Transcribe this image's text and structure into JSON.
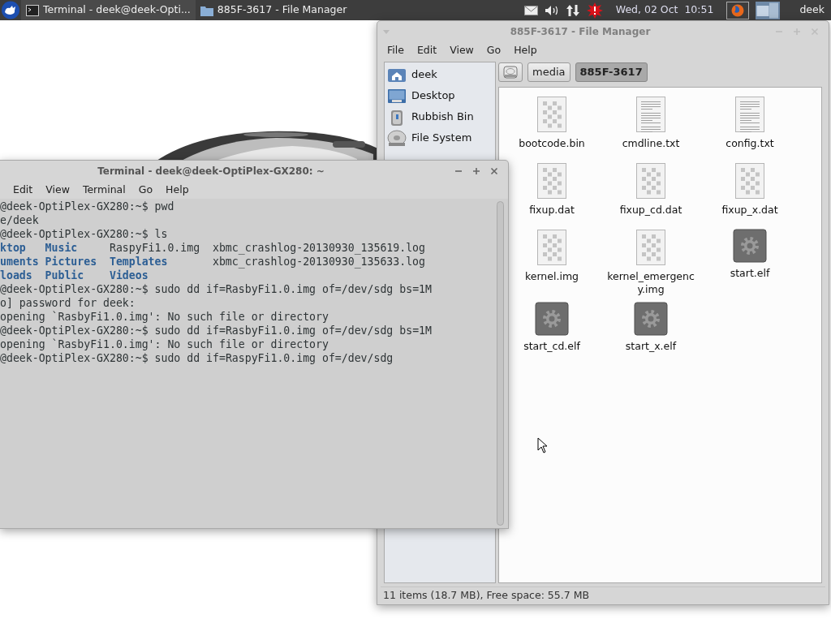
{
  "panel": {
    "tasks": [
      {
        "title": "Terminal - deek@deek-Opti...",
        "kind": "terminal",
        "selected": true
      },
      {
        "title": "885F-3617 - File Manager",
        "kind": "folder",
        "selected": false
      }
    ],
    "clock": "Wed, 02 Oct  10:51",
    "user": "deek"
  },
  "file_manager": {
    "title": "885F-3617 - File Manager",
    "menu": [
      "File",
      "Edit",
      "View",
      "Go",
      "Help"
    ],
    "sidebar": [
      {
        "label": "deek",
        "kind": "home"
      },
      {
        "label": "Desktop",
        "kind": "desktop"
      },
      {
        "label": "Rubbish Bin",
        "kind": "trash"
      },
      {
        "label": "File System",
        "kind": "drive"
      }
    ],
    "path": [
      {
        "label": "media",
        "selected": false
      },
      {
        "label": "885F-3617",
        "selected": true
      }
    ],
    "files": [
      {
        "name": "bootcode.bin",
        "kind": "binary"
      },
      {
        "name": "cmdline.txt",
        "kind": "text"
      },
      {
        "name": "config.txt",
        "kind": "text"
      },
      {
        "name": "fixup.dat",
        "kind": "binary"
      },
      {
        "name": "fixup_cd.dat",
        "kind": "binary"
      },
      {
        "name": "fixup_x.dat",
        "kind": "binary"
      },
      {
        "name": "kernel.img",
        "kind": "binary"
      },
      {
        "name": "kernel_emergency.img",
        "kind": "binary"
      },
      {
        "name": "start.elf",
        "kind": "executable"
      },
      {
        "name": "start_cd.elf",
        "kind": "executable"
      },
      {
        "name": "start_x.elf",
        "kind": "executable"
      }
    ],
    "status": "11 items (18.7 MB), Free space: 55.7 MB"
  },
  "terminal": {
    "title": "Terminal - deek@deek-OptiPlex-GX280: ~",
    "menu": [
      "Edit",
      "View",
      "Terminal",
      "Go",
      "Help"
    ],
    "lines": [
      {
        "kind": "text",
        "text": "@deek-OptiPlex-GX280:~$ pwd"
      },
      {
        "kind": "text",
        "text": "e/deek"
      },
      {
        "kind": "text",
        "text": "@deek-OptiPlex-GX280:~$ ls"
      },
      {
        "kind": "listing",
        "cells": [
          {
            "kind": "dir",
            "text": "ktop"
          },
          {
            "kind": "dir",
            "text": "Music"
          },
          {
            "kind": "file",
            "text": "RaspyFi1.0.img"
          },
          {
            "kind": "file",
            "text": "xbmc_crashlog-20130930_135619.log"
          }
        ]
      },
      {
        "kind": "listing",
        "cells": [
          {
            "kind": "dir",
            "text": "uments"
          },
          {
            "kind": "dir",
            "text": "Pictures"
          },
          {
            "kind": "dir",
            "text": "Templates"
          },
          {
            "kind": "file",
            "text": "xbmc_crashlog-20130930_135633.log"
          }
        ]
      },
      {
        "kind": "listing",
        "cells": [
          {
            "kind": "dir",
            "text": "loads"
          },
          {
            "kind": "dir",
            "text": "Public"
          },
          {
            "kind": "dir",
            "text": "Videos"
          }
        ]
      },
      {
        "kind": "text",
        "text": "@deek-OptiPlex-GX280:~$ sudo dd if=RasbyFi1.0.img of=/dev/sdg bs=1M"
      },
      {
        "kind": "text",
        "text": "o] password for deek:"
      },
      {
        "kind": "text",
        "text": "opening `RasbyFi1.0.img': No such file or directory"
      },
      {
        "kind": "text",
        "text": "@deek-OptiPlex-GX280:~$ sudo dd if=RasbyFi1.0.img of=/dev/sdg bs=1M"
      },
      {
        "kind": "text",
        "text": "opening `RasbyFi1.0.img': No such file or directory"
      },
      {
        "kind": "text",
        "text": "@deek-OptiPlex-GX280:~$ sudo dd if=RaspyFi1.0.img of=/dev/sdg"
      }
    ]
  }
}
